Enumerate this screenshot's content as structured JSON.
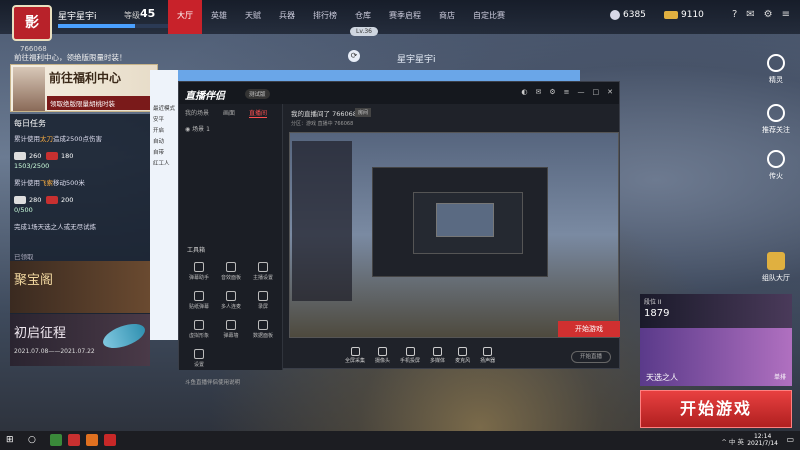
{
  "top": {
    "logo_text": "影",
    "player_name": "星宇星宇i",
    "uid": "766068",
    "level_label": "等级",
    "level": "45",
    "exp_progress": 0.7,
    "nav": [
      "大厅",
      "英雄",
      "天赋",
      "兵器",
      "排行榜",
      "仓库",
      "赛季启程",
      "商店",
      "自定比赛"
    ],
    "nav_active": 0,
    "silver": "6385",
    "gold": "9110",
    "lv_pill": "Lv.36",
    "header_name": "星宇星宇i",
    "icons": [
      "help-icon",
      "mail-icon",
      "settings-icon",
      "menu-icon"
    ]
  },
  "welfare": {
    "text": "前往福利中心，领绝版限量时装！",
    "title": "前往福利中心",
    "sub": "领取绝版限量胡桃时装"
  },
  "tasks": {
    "title": "每日任务",
    "task1_pre": "累计使用",
    "task1_hl": "太刀",
    "task1_post": "造成2500点伤害",
    "task1_progress": "1503/2500",
    "task1_rewards": [
      "260",
      "180"
    ],
    "task2_pre": "累计使用",
    "task2_hl": "飞索",
    "task2_post": "移动500米",
    "task2_progress": "0/500",
    "task2_rewards": [
      "280",
      "200"
    ],
    "task3": "完成1场天选之人或无尽试炼",
    "claimed": "已领取"
  },
  "events": {
    "treasure": "聚宝阁",
    "expedition": "初启征程",
    "expedition_date": "2021.07.08——2021.07.22"
  },
  "back_window": {
    "items": [
      "最近模式",
      "安平",
      "开启",
      "自动",
      "自带",
      "红工人"
    ]
  },
  "app": {
    "logo": "直播伴侣",
    "badge": "测试版",
    "tabs": [
      "我的场景",
      "画面",
      "直播间"
    ],
    "active_tab": 2,
    "scene": "场景 1",
    "room": "我的直播间了 766068",
    "room_badge": "房间",
    "room_info": "分区：游戏 直播中 766068",
    "tools_label": "工具箱",
    "tools": [
      "弹幕助手",
      "音效面板",
      "主播设置",
      "贴纸弹幕",
      "多人连麦",
      "录屏",
      "虚拟形象",
      "弹幕墙",
      "数据面板",
      "设置"
    ],
    "bottom_note": "斗鱼直播伴侣使用说明",
    "preview_button": "开始游戏",
    "toolbar": [
      "全屏采集",
      "摄像头",
      "手机投屏",
      "多媒体",
      "麦克风",
      "扬声器"
    ],
    "start_live": "开始直播"
  },
  "right_side": {
    "items": [
      "精灵",
      "推荐关注",
      "传火"
    ],
    "team_lobby": "组队大厅",
    "rank_label": "段位 II",
    "rank_num": "1879",
    "hero_name": "天选之人",
    "hero_mode": "单排",
    "start_game": "开始游戏"
  },
  "taskbar": {
    "time": "12:14",
    "date": "2021/7/14",
    "tray_text": "^ 中 英"
  }
}
